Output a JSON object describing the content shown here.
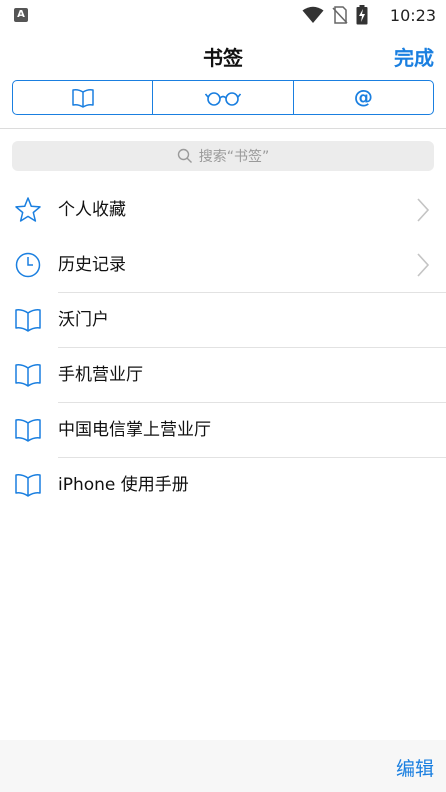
{
  "status_bar": {
    "app_badge": "A",
    "time": "10:23"
  },
  "nav": {
    "title": "书签",
    "done_label": "完成"
  },
  "segments": [
    {
      "icon": "book-icon"
    },
    {
      "icon": "glasses-icon"
    },
    {
      "icon": "at-icon",
      "glyph": "@"
    }
  ],
  "search": {
    "placeholder": "搜索“书签”"
  },
  "list": [
    {
      "icon": "star-icon",
      "label": "个人收藏",
      "chevron": true
    },
    {
      "icon": "clock-icon",
      "label": "历史记录",
      "chevron": true
    },
    {
      "icon": "book-icon",
      "label": "沃门户",
      "chevron": false
    },
    {
      "icon": "book-icon",
      "label": "手机营业厅",
      "chevron": false
    },
    {
      "icon": "book-icon",
      "label": "中国电信掌上营业厅",
      "chevron": false
    },
    {
      "icon": "book-icon",
      "label": "iPhone 使用手册",
      "chevron": false
    }
  ],
  "bottom": {
    "edit_label": "编辑"
  },
  "colors": {
    "accent": "#1a7fe0",
    "search_bg": "#ececec",
    "bottom_bg": "#f7f7f7"
  }
}
